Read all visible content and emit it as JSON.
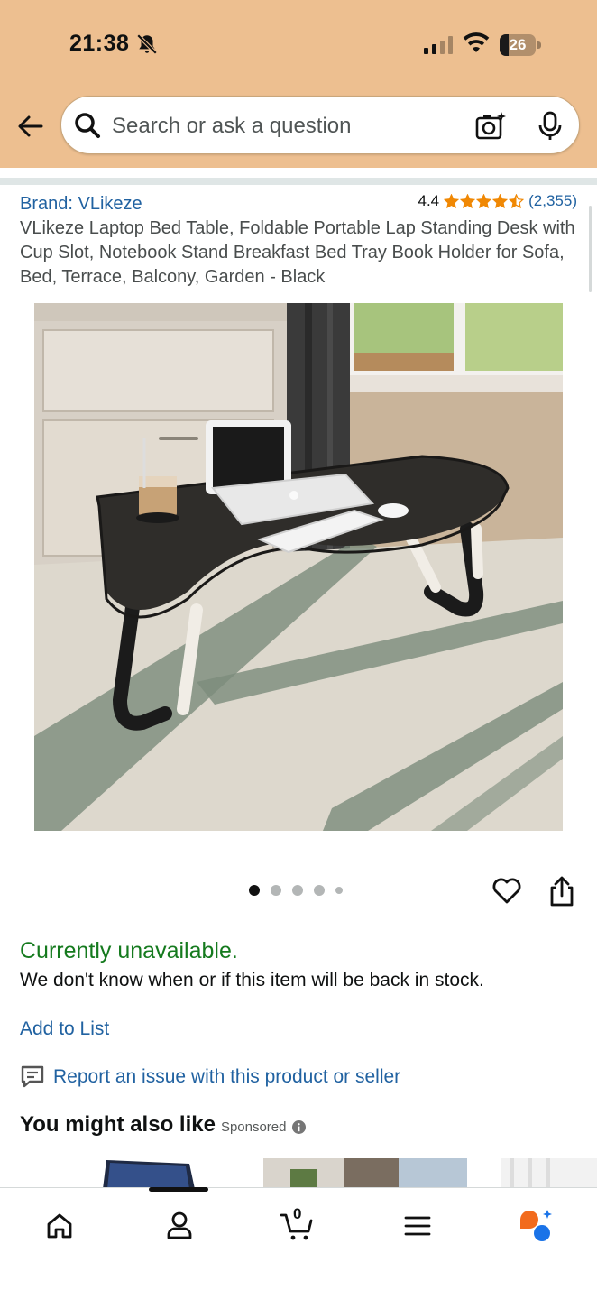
{
  "status_bar": {
    "time": "21:38",
    "battery": "26",
    "battery_level": 0.26
  },
  "search": {
    "placeholder": "Search or ask a question"
  },
  "product": {
    "brand": "Brand: VLikeze",
    "rating_value": "4.4",
    "rating_stars": 4.5,
    "rating_count": "(2,355)",
    "title": "VLikeze Laptop Bed Table, Foldable Portable Lap Standing Desk with Cup Slot, Notebook Stand Breakfast Bed Tray Book Holder for Sofa, Bed, Terrace, Balcony, Garden - Black",
    "image_count": 5,
    "active_image_index": 0
  },
  "availability": {
    "status": "Currently unavailable.",
    "message": "We don't know when or if this item will be back in stock."
  },
  "actions": {
    "add_to_list": "Add to List",
    "report_issue": "Report an issue with this product or seller"
  },
  "recommendations": {
    "title": "You might also like",
    "sponsored_label": "Sponsored"
  },
  "bottom_nav": {
    "items": [
      "home-icon",
      "account-icon",
      "cart-icon",
      "menu-icon",
      "rufus-icon"
    ],
    "cart_count": "0"
  },
  "colors": {
    "header_bg": "#edbf90",
    "link": "#2162a1",
    "unavailable": "#157a1e",
    "star": "#f08804"
  }
}
